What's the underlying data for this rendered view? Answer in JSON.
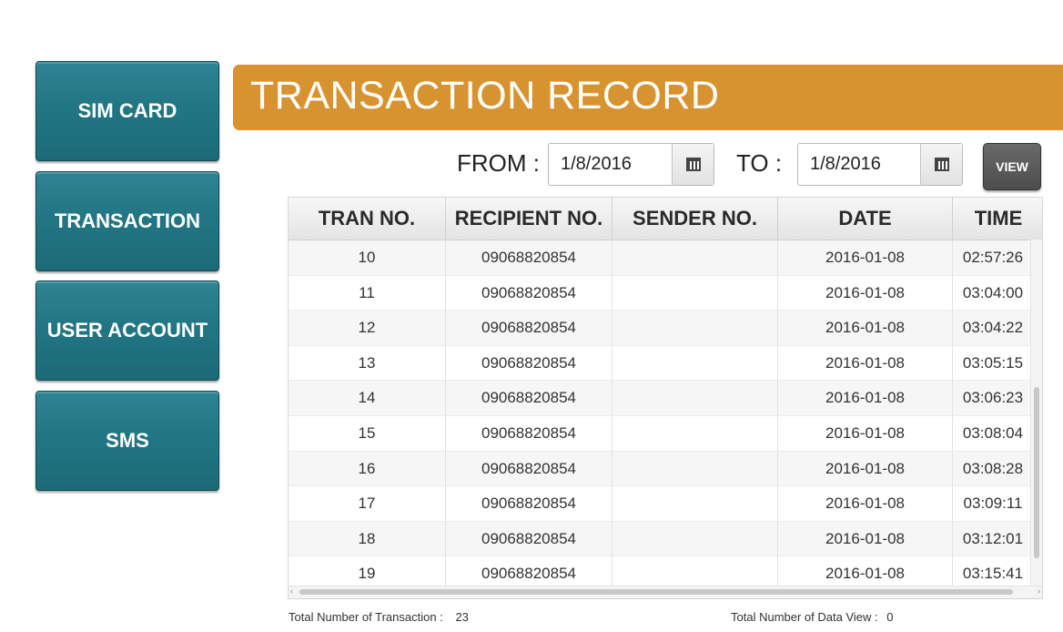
{
  "sidebar": {
    "items": [
      {
        "label": "SIM CARD"
      },
      {
        "label": "TRANSACTION"
      },
      {
        "label": "USER ACCOUNT"
      },
      {
        "label": "SMS"
      }
    ]
  },
  "header": {
    "title": "TRANSACTION RECORD"
  },
  "filter": {
    "from_label": "FROM :",
    "from_value": "1/8/2016",
    "to_label": "TO :",
    "to_value": "1/8/2016",
    "view_label": "VIEW"
  },
  "table": {
    "columns": [
      "TRAN NO.",
      "RECIPIENT NO.",
      "SENDER NO.",
      "DATE",
      "TIME"
    ],
    "rows": [
      [
        "10",
        "09068820854",
        "",
        "2016-01-08",
        "02:57:26"
      ],
      [
        "11",
        "09068820854",
        "",
        "2016-01-08",
        "03:04:00"
      ],
      [
        "12",
        "09068820854",
        "",
        "2016-01-08",
        "03:04:22"
      ],
      [
        "13",
        "09068820854",
        "",
        "2016-01-08",
        "03:05:15"
      ],
      [
        "14",
        "09068820854",
        "",
        "2016-01-08",
        "03:06:23"
      ],
      [
        "15",
        "09068820854",
        "",
        "2016-01-08",
        "03:08:04"
      ],
      [
        "16",
        "09068820854",
        "",
        "2016-01-08",
        "03:08:28"
      ],
      [
        "17",
        "09068820854",
        "",
        "2016-01-08",
        "03:09:11"
      ],
      [
        "18",
        "09068820854",
        "",
        "2016-01-08",
        "03:12:01"
      ],
      [
        "19",
        "09068820854",
        "",
        "2016-01-08",
        "03:15:41"
      ]
    ]
  },
  "footer": {
    "total_transaction_label": "Total Number of Transaction :",
    "total_transaction_value": "23",
    "total_view_label": "Total Number of Data View :",
    "total_view_value": "0"
  },
  "icons": {
    "calendar": "calendar-icon"
  }
}
